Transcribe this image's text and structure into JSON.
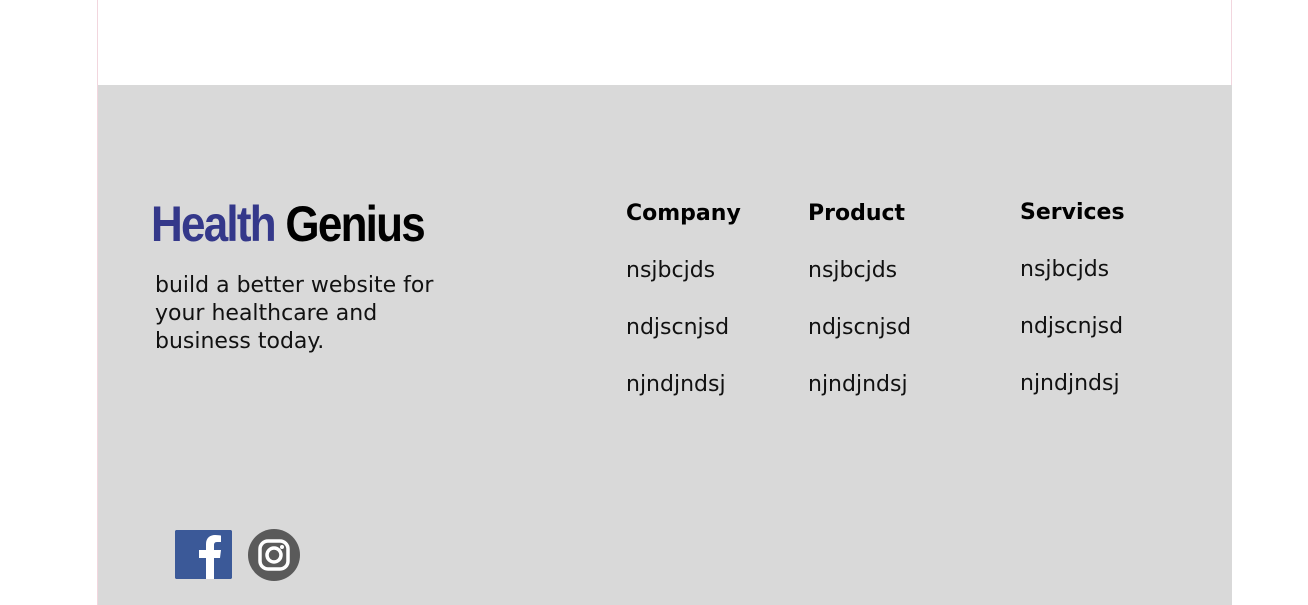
{
  "brand": {
    "logo_part1": "Health",
    "logo_part2": "Genius",
    "logo_color_primary": "#34388a",
    "logo_color_secondary": "#000000",
    "tagline": "build a better website for your healthcare and business today."
  },
  "footer": {
    "background": "#d9d9d9",
    "columns": [
      {
        "title": "Company",
        "links": [
          "nsjbcjds",
          "ndjscnjsd",
          "njndjndsj"
        ]
      },
      {
        "title": "Product",
        "links": [
          "nsjbcjds",
          "ndjscnjsd",
          "njndjndsj"
        ]
      },
      {
        "title": "Services",
        "links": [
          "nsjbcjds",
          "ndjscnjsd",
          "njndjndsj"
        ]
      }
    ],
    "social": [
      {
        "icon": "facebook-icon",
        "color": "#3b5998"
      },
      {
        "icon": "instagram-icon",
        "color": "#5a5a5a"
      }
    ]
  }
}
